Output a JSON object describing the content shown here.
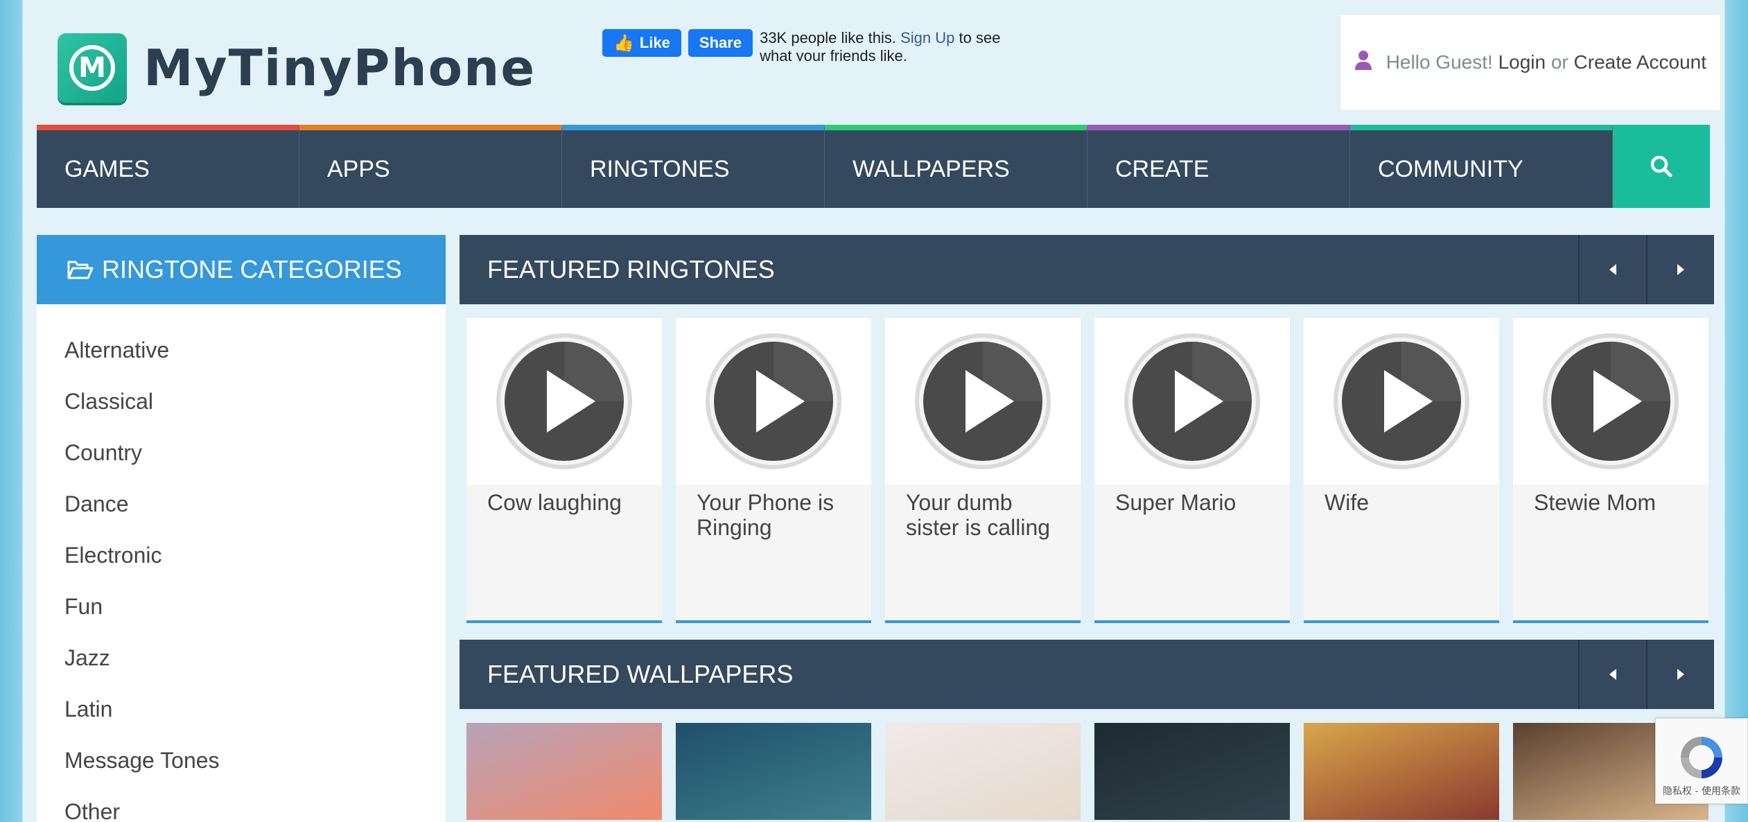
{
  "brand": {
    "logo_letter": "M",
    "name": "MyTinyPhone"
  },
  "facebook": {
    "like_label": "Like",
    "share_label": "Share",
    "count_text": "33K people like this.",
    "signup_link": "Sign Up",
    "suffix_text": "to see what your friends like."
  },
  "account": {
    "greeting": "Hello Guest!",
    "login_label": "Login",
    "or_text": "or",
    "create_label": "Create Account",
    "icon": "user-icon"
  },
  "nav": {
    "items": [
      {
        "label": "GAMES",
        "color": "#e74c3c"
      },
      {
        "label": "APPS",
        "color": "#e67e22"
      },
      {
        "label": "RINGTONES",
        "color": "#3498db"
      },
      {
        "label": "WALLPAPERS",
        "color": "#2ecc71"
      },
      {
        "label": "CREATE",
        "color": "#9b59b6"
      },
      {
        "label": "COMMUNITY",
        "color": "#1abc9c"
      }
    ],
    "search_icon": "search-icon"
  },
  "sidebar": {
    "title": "RINGTONE CATEGORIES",
    "icon": "folder-open-icon",
    "categories": [
      "Alternative",
      "Classical",
      "Country",
      "Dance",
      "Electronic",
      "Fun",
      "Jazz",
      "Latin",
      "Message Tones",
      "Other"
    ]
  },
  "featured_ringtones": {
    "title": "FEATURED RINGTONES",
    "items": [
      {
        "title": "Cow laughing"
      },
      {
        "title": "Your Phone is Ringing"
      },
      {
        "title": "Your dumb sister is calling"
      },
      {
        "title": "Super Mario"
      },
      {
        "title": "Wife"
      },
      {
        "title": "Stewie Mom"
      }
    ]
  },
  "featured_wallpapers": {
    "title": "FEATURED WALLPAPERS",
    "items": [
      {
        "colors": [
          "#b7a3b8",
          "#f08a6c"
        ]
      },
      {
        "colors": [
          "#1f4f6a",
          "#3e7f8f"
        ]
      },
      {
        "colors": [
          "#f0ebe6",
          "#e6d8cc"
        ]
      },
      {
        "colors": [
          "#1e2a33",
          "#33424c"
        ]
      },
      {
        "colors": [
          "#d9a64a",
          "#8a3a2f"
        ]
      },
      {
        "colors": [
          "#5a4030",
          "#d9b58a"
        ]
      }
    ]
  },
  "recaptcha": {
    "footer": "隐私权 - 使用条款"
  }
}
